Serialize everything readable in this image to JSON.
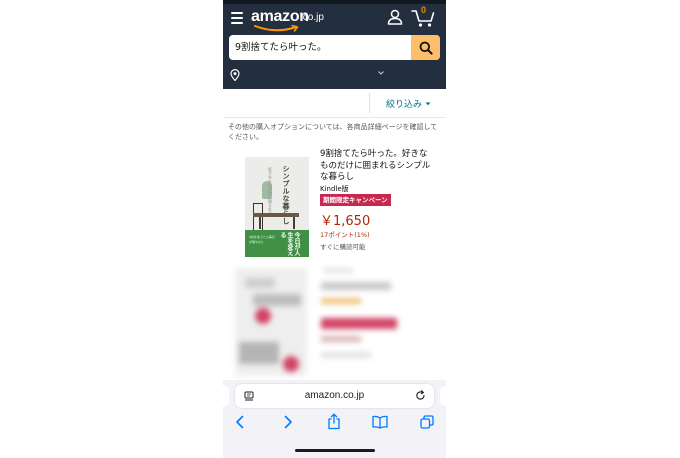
{
  "header": {
    "logo_text": "amazon",
    "logo_tld": ".co.jp",
    "cart_count": "0"
  },
  "search": {
    "query": "9割捨てたら叶った。"
  },
  "filter": {
    "label": "絞り込み"
  },
  "info_text": "その他の購入オプションについては、各商品詳細ページを確認してください。",
  "result": {
    "title": "9割捨てたら叶った。好きなものだけに囲まれるシンプルな暮らし",
    "format": "Kindle版",
    "promo": "期間限定キャンペーン",
    "price": "￥1,650",
    "points": "17ポイント(1%)",
    "availability": "すぐに購読可能",
    "cover": {
      "title": "シンプルな暮らし",
      "subtitle": "好きなものだけに囲まれる",
      "band_text": "今日が人生を変える",
      "band_small": "9割を捨てたら毎日が軽やかに"
    }
  },
  "browser": {
    "url": "amazon.co.jp"
  },
  "colors": {
    "header_bg": "#232f3e",
    "search_button": "#febd69",
    "promo_badge": "#c7284e",
    "price": "#b12704",
    "link": "#007185",
    "ios_blue": "#007aff"
  },
  "icons": [
    "hamburger-icon",
    "user-icon",
    "cart-icon",
    "search-icon",
    "location-pin-icon",
    "chevron-down-icon",
    "reader-icon",
    "reload-icon",
    "back-icon",
    "forward-icon",
    "share-icon",
    "bookmarks-icon",
    "tabs-icon"
  ]
}
